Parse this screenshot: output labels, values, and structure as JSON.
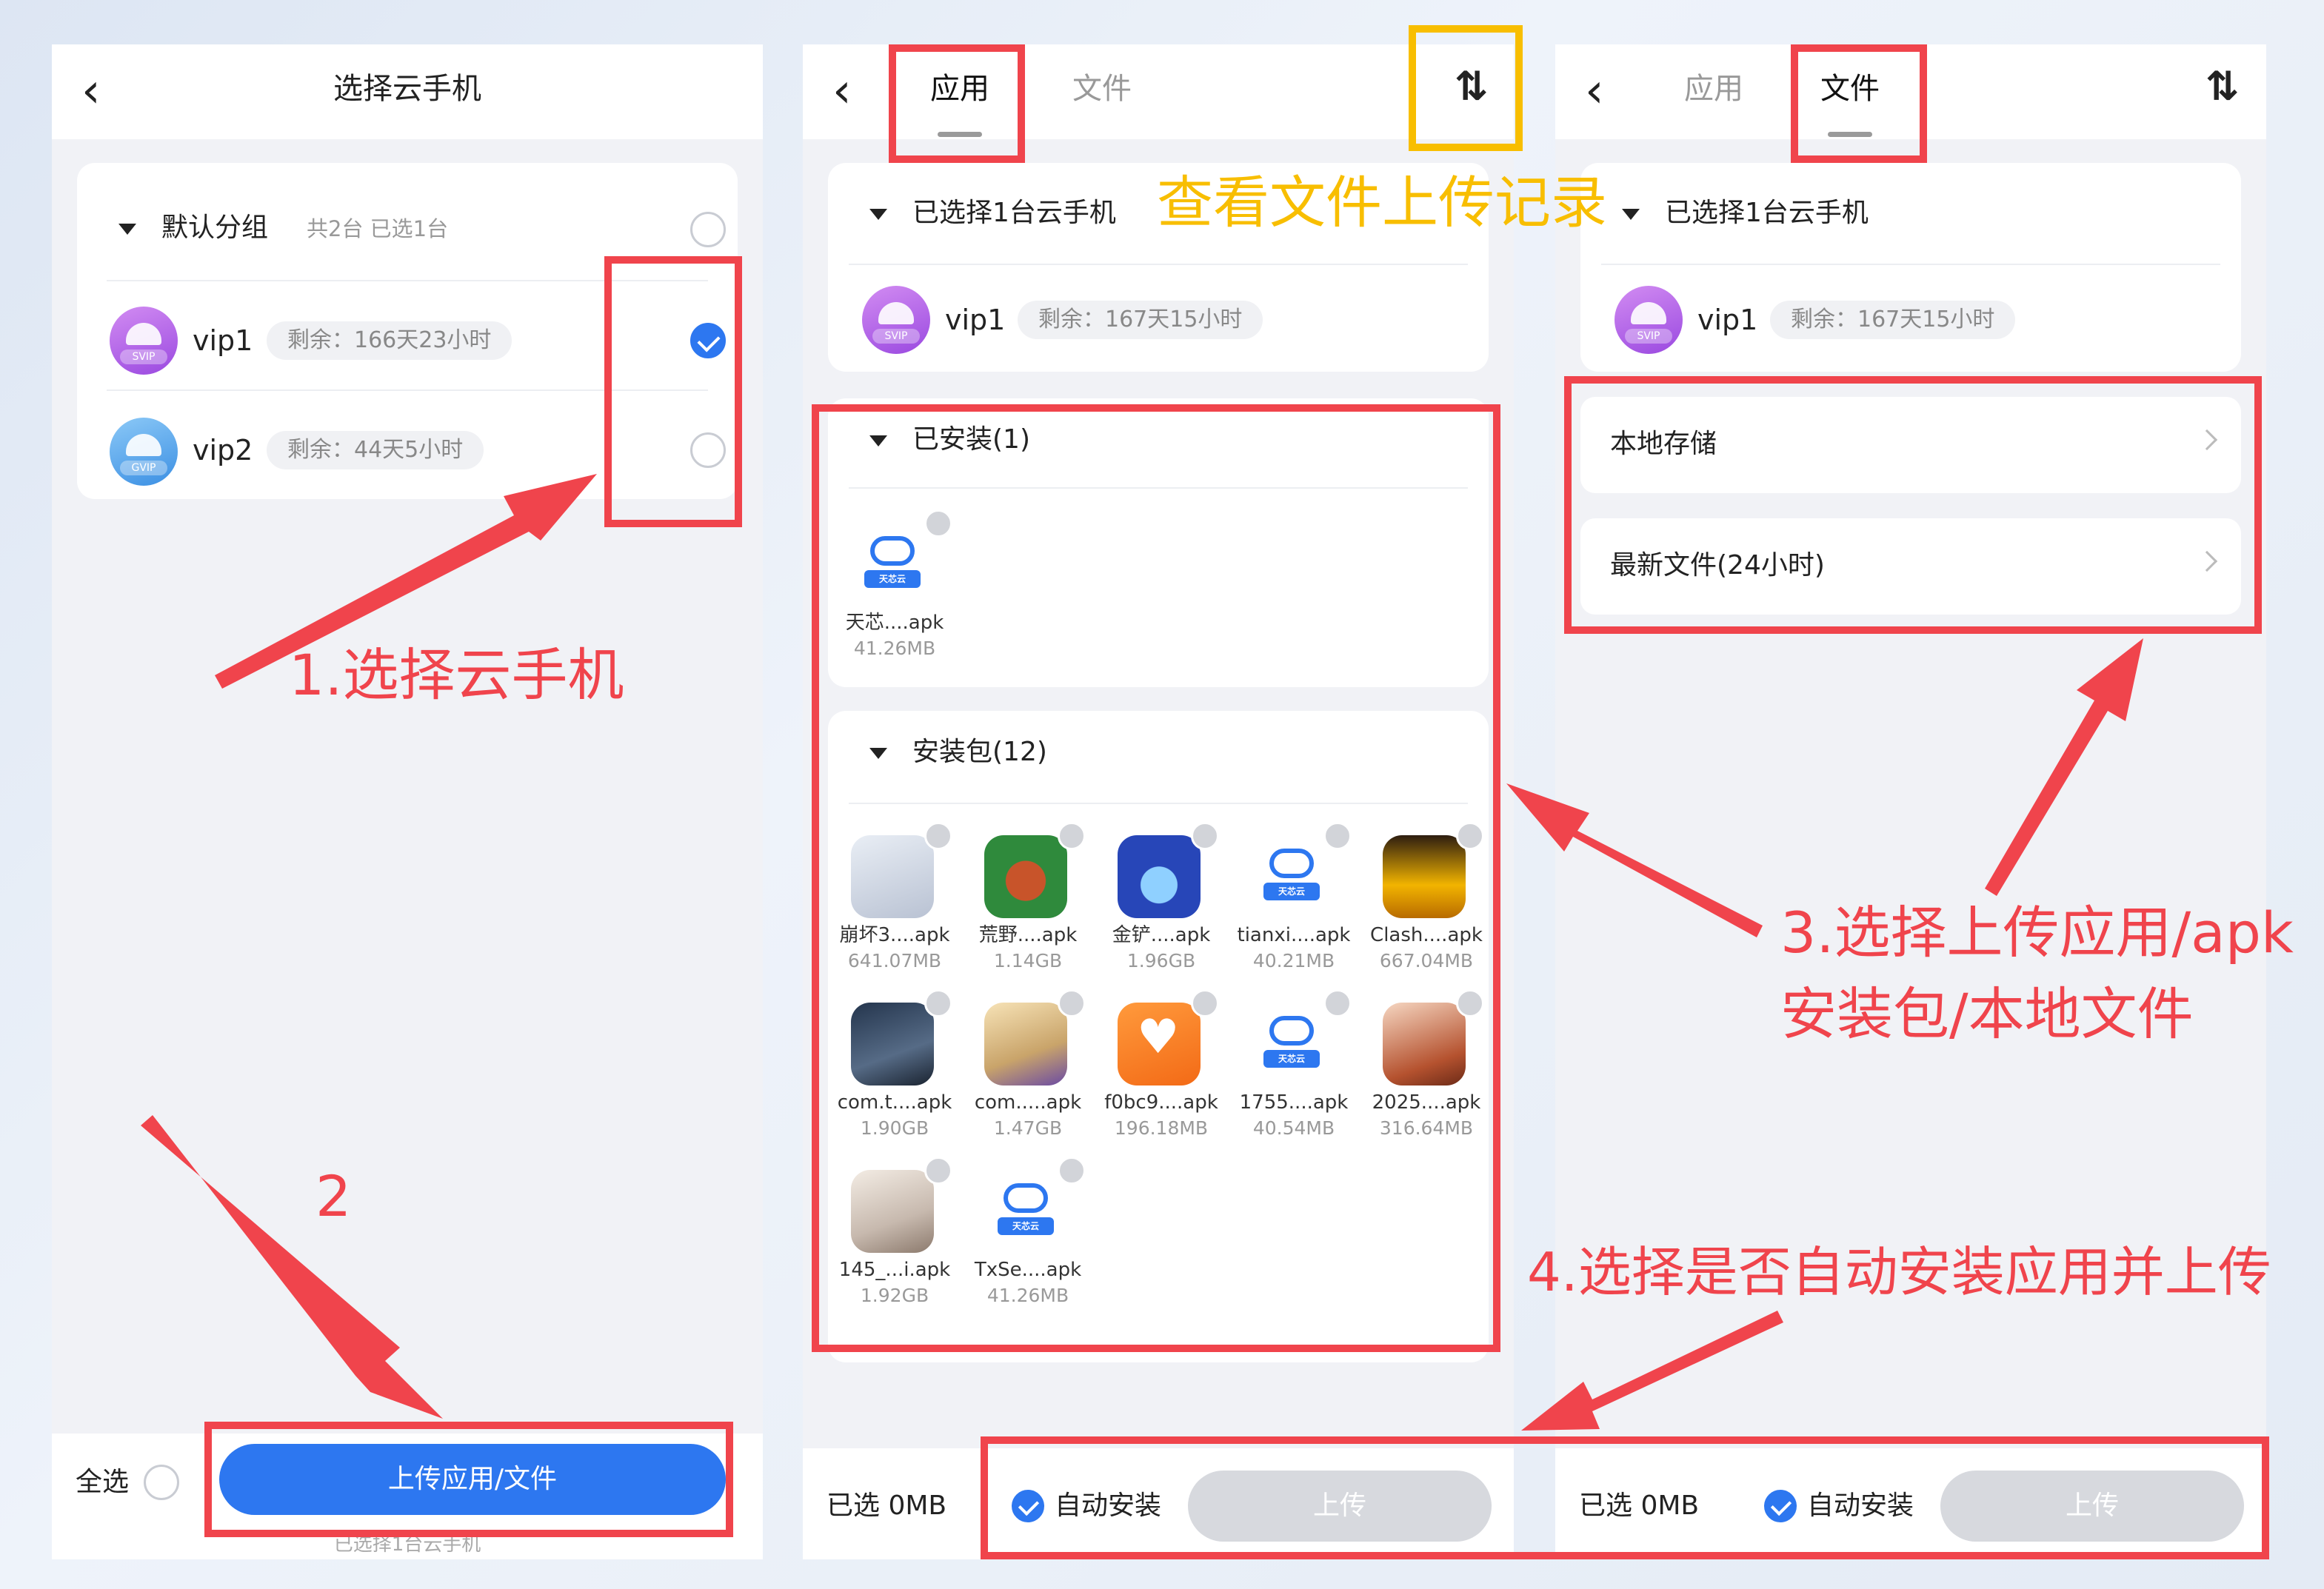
{
  "panel1": {
    "title": "选择云手机",
    "group": {
      "name": "默认分组",
      "meta": "共2台 已选1台"
    },
    "devices": [
      {
        "name": "vip1",
        "tag": "SVIP",
        "remaining": "剩余：166天23小时",
        "selected": true
      },
      {
        "name": "vip2",
        "tag": "GVIP",
        "remaining": "剩余：44天5小时",
        "selected": false
      }
    ],
    "select_all": "全选",
    "upload_button": "上传应用/文件",
    "footer_note": "已选择1台云手机"
  },
  "panel2": {
    "tabs": [
      "应用",
      "文件"
    ],
    "active_tab": "应用",
    "selected_header": "已选择1台云手机",
    "device": {
      "name": "vip1",
      "tag": "SVIP",
      "remaining": "剩余：167天15小时"
    },
    "installed_section": "已安装(1)",
    "installed": [
      {
        "name": "天芯....apk",
        "size": "41.26MB",
        "icon": "cloud-icon"
      }
    ],
    "packages_section": "安装包(12)",
    "packages": [
      {
        "name": "崩坏3....apk",
        "size": "641.07MB",
        "icon": "anime-icon"
      },
      {
        "name": "荒野....apk",
        "size": "1.14GB",
        "icon": "bear-icon"
      },
      {
        "name": "金铲....apk",
        "size": "1.96GB",
        "icon": "penguin-icon"
      },
      {
        "name": "tianxi....apk",
        "size": "40.21MB",
        "icon": "cloud-icon"
      },
      {
        "name": "Clash....apk",
        "size": "667.04MB",
        "icon": "clash-icon"
      },
      {
        "name": "com.t....apk",
        "size": "1.90GB",
        "icon": "soldier-icon"
      },
      {
        "name": "com.....apk",
        "size": "1.47GB",
        "icon": "anime-girl-icon"
      },
      {
        "name": "f0bc9....apk",
        "size": "196.18MB",
        "icon": "heart-icon"
      },
      {
        "name": "1755....apk",
        "size": "40.54MB",
        "icon": "cloud-icon"
      },
      {
        "name": "2025....apk",
        "size": "316.64MB",
        "icon": "cartoon-icon"
      },
      {
        "name": "145_...i.apk",
        "size": "1.92GB",
        "icon": "white-hair-icon"
      },
      {
        "name": "TxSe....apk",
        "size": "41.26MB",
        "icon": "cloud-icon"
      }
    ],
    "selected_size": "已选 0MB",
    "auto_install": "自动安装",
    "upload": "上传"
  },
  "panel3": {
    "tabs": [
      "应用",
      "文件"
    ],
    "active_tab": "文件",
    "selected_header": "已选择1台云手机",
    "device": {
      "name": "vip1",
      "tag": "SVIP",
      "remaining": "剩余：167天15小时"
    },
    "rows": [
      "本地存储",
      "最新文件(24小时)"
    ],
    "selected_size": "已选 0MB",
    "auto_install": "自动安装",
    "upload": "上传"
  },
  "annotations": {
    "step1": "1.选择云手机",
    "step2": "2",
    "step3_line1": "3.选择上传应用/apk",
    "step3_line2": "安装包/本地文件",
    "step4": "4.选择是否自动安装应用并上传",
    "view_log": "查看文件上传记录"
  },
  "colors": {
    "accent": "#2d77f0",
    "annotation_red": "#f0444c",
    "annotation_yellow": "#f8be00"
  },
  "cloud_icon_text": "天芯云"
}
